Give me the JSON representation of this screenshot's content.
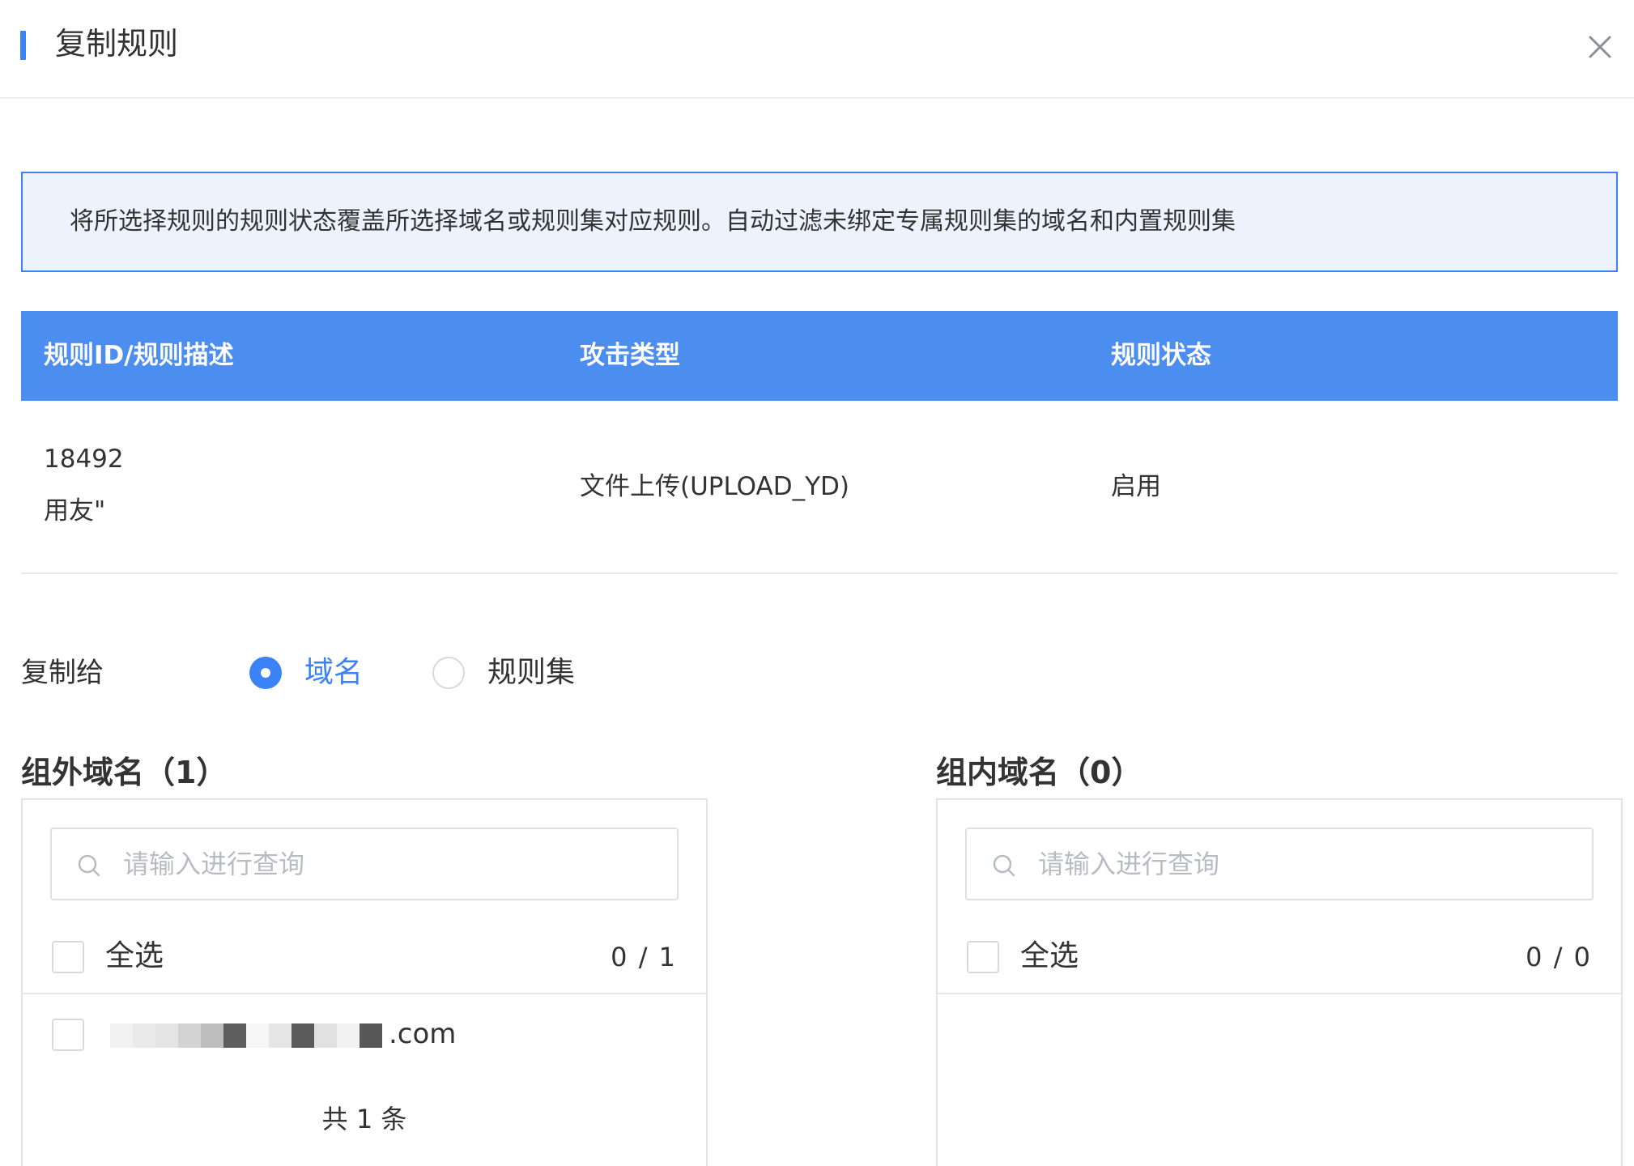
{
  "dialog": {
    "title": "复制规则"
  },
  "notice": {
    "text": "将所选择规则的规则状态覆盖所选择域名或规则集对应规则。自动过滤未绑定专属规则集的域名和内置规则集"
  },
  "table": {
    "headers": [
      "规则ID/规则描述",
      "攻击类型",
      "规则状态"
    ],
    "rows": [
      {
        "rule_id": "18492",
        "description": "用友\"",
        "attack_type": "文件上传(UPLOAD_YD)",
        "status": "启用"
      }
    ]
  },
  "copy_to": {
    "label": "复制给",
    "options": [
      {
        "label": "域名",
        "selected": true
      },
      {
        "label": "规则集",
        "selected": false
      }
    ]
  },
  "transfer": {
    "left": {
      "title": "组外域名（1）",
      "search_placeholder": "请输入进行查询",
      "select_all_label": "全选",
      "count": "0 / 1",
      "items": [
        {
          "domain_suffix": ".com",
          "checked": false
        }
      ],
      "total": "共 1 条"
    },
    "right": {
      "title": "组内域名（0）",
      "search_placeholder": "请输入进行查询",
      "select_all_label": "全选",
      "count": "0 / 0",
      "items": []
    }
  },
  "colors": {
    "accent": "#3b82f6",
    "table_header_bg": "#4c8ef0",
    "notice_bg": "#edf3fd"
  },
  "icons": {
    "close": "close-icon",
    "search": "search-icon"
  }
}
